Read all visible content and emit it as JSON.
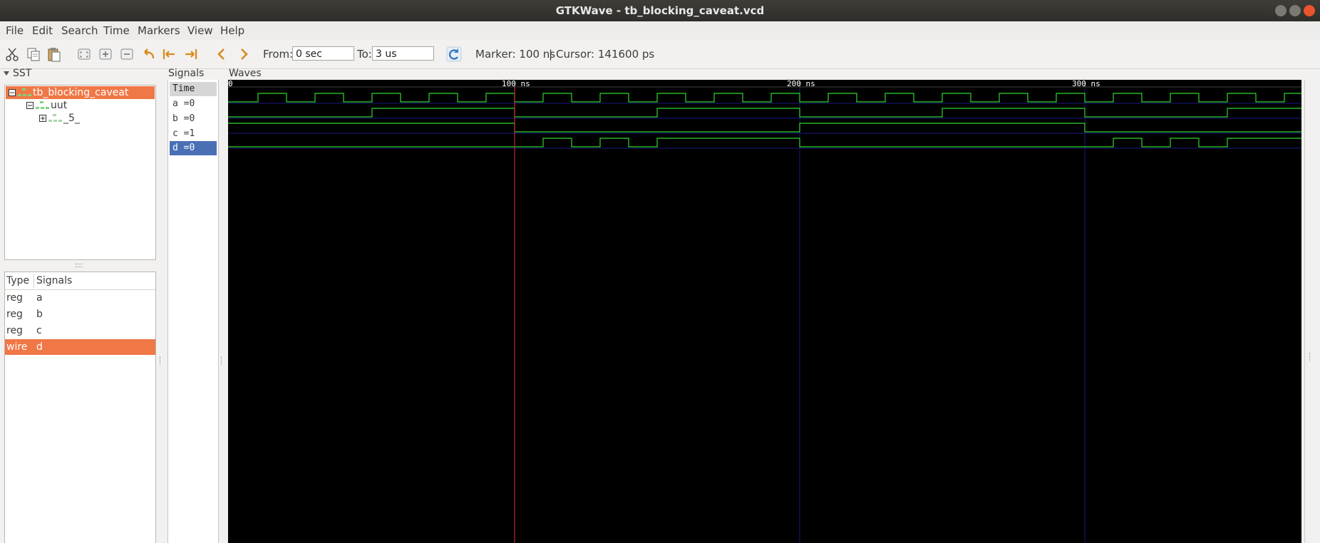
{
  "window": {
    "title": "GTKWave - tb_blocking_caveat.vcd"
  },
  "menu": [
    "File",
    "Edit",
    "Search",
    "Time",
    "Markers",
    "View",
    "Help"
  ],
  "toolbar": {
    "from_label": "From:",
    "from_value": "0 sec",
    "to_label": "To:",
    "to_value": "3 us",
    "marker_text": "Marker: 100 ns",
    "separator": "|",
    "cursor_text": "Cursor: 141600 ps"
  },
  "sst": {
    "header": "SST",
    "tree": [
      {
        "label": "tb_blocking_caveat",
        "selected": true
      },
      {
        "label": "uut",
        "selected": false
      },
      {
        "label": "_5_",
        "selected": false
      }
    ]
  },
  "signal_list": {
    "col_type": "Type",
    "col_signals": "Signals",
    "rows": [
      {
        "type": "reg",
        "name": "a",
        "selected": false
      },
      {
        "type": "reg",
        "name": "b",
        "selected": false
      },
      {
        "type": "reg",
        "name": "c",
        "selected": false
      },
      {
        "type": "wire",
        "name": "d",
        "selected": true
      }
    ]
  },
  "signals_panel": {
    "header": "Signals",
    "rows": [
      {
        "label": "Time",
        "kind": "time"
      },
      {
        "label": "a =0",
        "kind": "sig"
      },
      {
        "label": "b =0",
        "kind": "sig"
      },
      {
        "label": "c =1",
        "kind": "sig"
      },
      {
        "label": "d =0",
        "kind": "sig",
        "selected": true
      }
    ]
  },
  "waves": {
    "header": "Waves",
    "time_labels": [
      {
        "t": 0,
        "label": "0"
      },
      {
        "t": 100,
        "label": "100 ns"
      },
      {
        "t": 200,
        "label": "200 ns"
      },
      {
        "t": 300,
        "label": "300 ns"
      }
    ],
    "marker_ns": 100,
    "range_ns": 376,
    "signals": {
      "a": {
        "init": 0,
        "toggles": [
          10,
          20,
          30,
          40,
          50,
          60,
          70,
          80,
          90,
          100,
          110,
          120,
          130,
          140,
          150,
          160,
          170,
          180,
          190,
          200,
          210,
          220,
          230,
          240,
          250,
          260,
          270,
          280,
          290,
          300,
          310,
          320,
          330,
          340,
          350,
          360,
          370
        ]
      },
      "b": {
        "init": 0,
        "toggles": [
          50,
          100,
          150,
          200,
          250,
          300,
          350
        ]
      },
      "c": {
        "init": 1,
        "toggles": [
          100,
          200,
          300
        ]
      },
      "d": {
        "init": 0,
        "toggles": [
          110,
          120,
          130,
          140,
          150,
          200,
          310,
          320,
          330,
          340,
          350
        ]
      }
    },
    "colors": {
      "background": "#000000",
      "trace": "#2fd62f",
      "marker": "#e03030",
      "grid": "#1a1a80",
      "axis_text": "#ffffff"
    }
  },
  "colors": {
    "selection_orange": "#f07746",
    "selection_blue": "#4a6fb5"
  }
}
